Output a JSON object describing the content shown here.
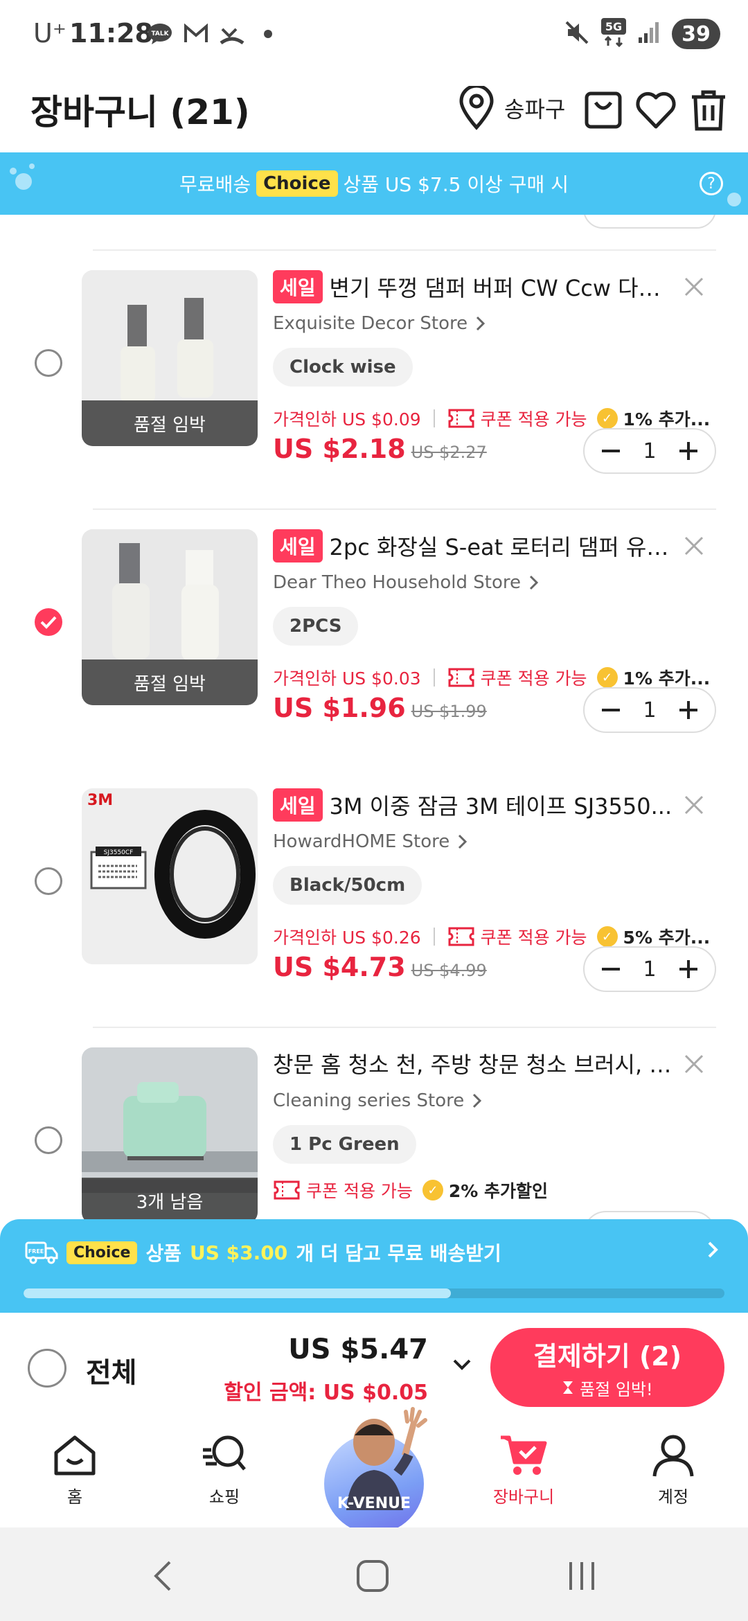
{
  "status_bar": {
    "carrier": "U⁺",
    "time": "11:28",
    "battery": "39",
    "network": "5G"
  },
  "header": {
    "title": "장바구니 (21)",
    "location": "송파구"
  },
  "choice_banner": {
    "prefix": "무료배송",
    "badge": "Choice",
    "suffix": "상품 US $7.5 이상 구매 시",
    "help": "?"
  },
  "items": [
    {
      "checked": false,
      "sale_tag": "세일",
      "name": "변기 뚜껑 댐퍼 버퍼 CW Ccw 다기...",
      "store": "Exquisite Decor Store",
      "variant": "Clock wise",
      "stock_overlay": "품절 임박",
      "price_drop": "가격인하 US $0.09",
      "coupon": "쿠폰 적용 가능",
      "extra": "1% 추가...",
      "price": "US $2.18",
      "old_price": "US $2.27",
      "qty": "1",
      "thumb_icon": "white-damper-pair"
    },
    {
      "checked": true,
      "sale_tag": "세일",
      "name": "2pc 화장실 S-eat 로터리 댐퍼 유압...",
      "store": "Dear Theo Household Store",
      "variant": "2PCS",
      "stock_overlay": "품절 임박",
      "price_drop": "가격인하 US $0.03",
      "coupon": "쿠폰 적용 가능",
      "extra": "1% 추가...",
      "price": "US $1.96",
      "old_price": "US $1.99",
      "qty": "1",
      "thumb_icon": "white-damper-pair"
    },
    {
      "checked": false,
      "sale_tag": "세일",
      "name": "3M 이중 잠금 3M 테이프 SJ3550...",
      "store": "HowardHOME Store",
      "variant": "Black/50cm",
      "stock_overlay": "",
      "price_drop": "가격인하 US $0.26",
      "coupon": "쿠폰 적용 가능",
      "extra": "5% 추가...",
      "price": "US $4.73",
      "old_price": "US $4.99",
      "qty": "1",
      "thumb_icon": "3m-tape-roll",
      "thumb_brand": "3M",
      "thumb_label": "SJ3550CF"
    },
    {
      "checked": false,
      "sale_tag": "",
      "name": "창문 홈 청소 천, 주방 창문 청소 브러시, 창...",
      "store": "Cleaning series Store",
      "variant": "1 Pc Green",
      "stock_overlay": "3개 남음",
      "price_drop": "",
      "coupon": "쿠폰 적용 가능",
      "extra": "2% 추가할인",
      "thumb_icon": "green-window-brush"
    }
  ],
  "shipping_bar": {
    "badge": "Choice",
    "prefix": "상품",
    "amount": "US $3.00",
    "suffix": "개 더 담고 무료 배송받기",
    "progress": 0.61
  },
  "checkout": {
    "select_all": "전체",
    "total": "US $5.47",
    "discount": "할인 금액: US $0.05",
    "button": "결제하기 (2)",
    "button_sub": "품절 임박!"
  },
  "bottom_nav": {
    "home": "홈",
    "shopping": "쇼핑",
    "kvenue": "K-VENUE",
    "cart": "장바구니",
    "account": "계정"
  },
  "colors": {
    "accent": "#ff3b5c",
    "price_red": "#e8243f",
    "banner_blue": "#48c4f3",
    "choice_yellow": "#ffe14a"
  }
}
